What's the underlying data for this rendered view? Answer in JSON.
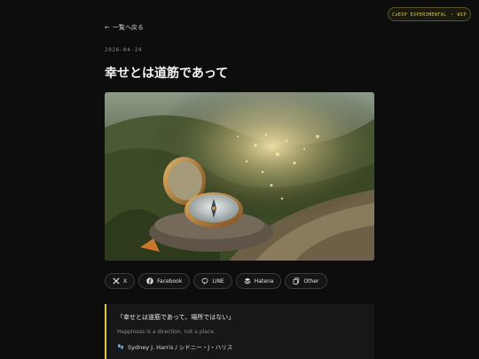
{
  "badge": {
    "label": "CoEXP EXPERIMENTAL ・ WIP"
  },
  "nav": {
    "back_arrow": "←",
    "back_label": "一覧へ戻る"
  },
  "article": {
    "date": "2026-04-24",
    "title": "幸せとは道筋であって",
    "hero_image": {
      "icon": "compass-photo"
    }
  },
  "share": {
    "buttons": [
      {
        "icon": "x-icon",
        "label": "X"
      },
      {
        "icon": "facebook-icon",
        "label": "Facebook"
      },
      {
        "icon": "line-icon",
        "label": "LINE"
      },
      {
        "icon": "hatena-icon",
        "label": "Hatena"
      },
      {
        "icon": "copy-icon",
        "label": "Other"
      }
    ]
  },
  "quote": {
    "text": "「幸せとは道筋であって、場所ではない」",
    "english": "Happiness is a direction, not a place.",
    "author": "Sydney J. Harris / シドニー・J・ハリス",
    "author_icon": "footprints-icon"
  },
  "colors": {
    "accent": "#e0c84c",
    "background": "#0d0d0d"
  }
}
